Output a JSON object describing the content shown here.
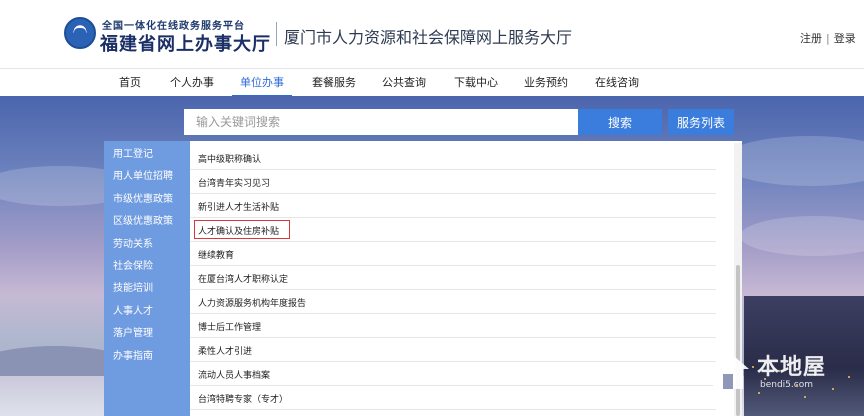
{
  "header": {
    "logo_line1": "全国一体化在线政务服务平台",
    "logo_line2": "福建省网上办事大厅",
    "site_title": "厦门市人力资源和社会保障网上服务大厅",
    "register": "注册",
    "separator": "|",
    "login": "登录"
  },
  "nav": {
    "items": [
      {
        "label": "首页"
      },
      {
        "label": "个人办事"
      },
      {
        "label": "单位办事",
        "active": true
      },
      {
        "label": "套餐服务"
      },
      {
        "label": "公共查询"
      },
      {
        "label": "下载中心"
      },
      {
        "label": "业务预约"
      },
      {
        "label": "在线咨询"
      }
    ],
    "accent_color": "#2f6bd8"
  },
  "search": {
    "placeholder": "输入关键词搜索",
    "value": "",
    "search_label": "搜索",
    "service_list_label": "服务列表",
    "button_color": "#3b7ddd"
  },
  "sidebar": {
    "background": "#6f9be0",
    "items": [
      {
        "label": "用工登记"
      },
      {
        "label": "用人单位招聘"
      },
      {
        "label": "市级优惠政策"
      },
      {
        "label": "区级优惠政策"
      },
      {
        "label": "劳动关系"
      },
      {
        "label": "社会保险"
      },
      {
        "label": "技能培训"
      },
      {
        "label": "人事人才"
      },
      {
        "label": "落户管理"
      },
      {
        "label": "办事指南"
      }
    ]
  },
  "content": {
    "items": [
      {
        "label": "高中级职称确认"
      },
      {
        "label": "台湾青年实习见习"
      },
      {
        "label": "新引进人才生活补贴"
      },
      {
        "label": "人才确认及住房补贴",
        "highlighted": true
      },
      {
        "label": "继续教育"
      },
      {
        "label": "在厦台湾人才职称认定"
      },
      {
        "label": "人力资源服务机构年度报告"
      },
      {
        "label": "博士后工作管理"
      },
      {
        "label": "柔性人才引进"
      },
      {
        "label": "流动人员人事档案"
      },
      {
        "label": "台湾特聘专家（专才）"
      }
    ],
    "highlight_color": "#d9363e"
  },
  "watermark": {
    "icon": "house-icon",
    "text": "本地屋",
    "url": "bendi5.com"
  }
}
